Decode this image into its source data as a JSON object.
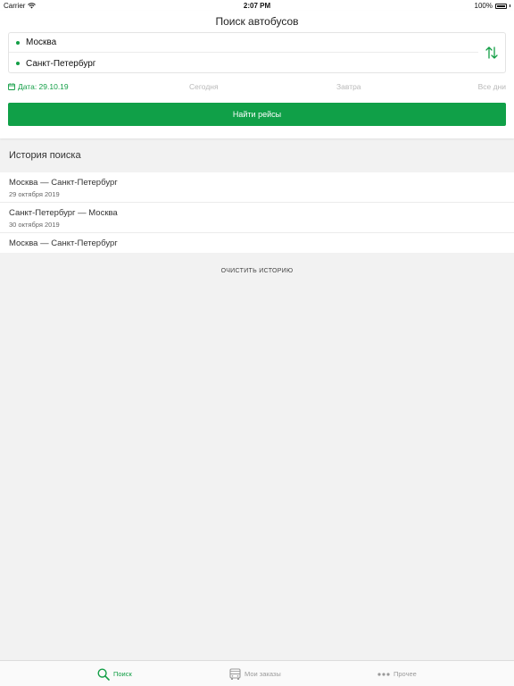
{
  "status_bar": {
    "carrier": "Carrier",
    "time": "2:07 PM",
    "battery": "100%",
    "icons": [
      "wifi-icon",
      "battery-icon"
    ]
  },
  "header": {
    "title": "Поиск автобусов"
  },
  "route": {
    "from": "Москва",
    "to": "Санкт-Петербург",
    "swap_icon": "swap-vertical-arrows-icon"
  },
  "date_bar": {
    "selected": "Дата: 29.10.19",
    "today": "Сегодня",
    "tomorrow": "Завтра",
    "all_days": "Все дни",
    "icon": "calendar-icon"
  },
  "find_button": {
    "label": "Найти рейсы"
  },
  "history": {
    "title": "История поиска",
    "items": [
      {
        "route": "Москва — Санкт-Петербург",
        "date": "29 октября 2019"
      },
      {
        "route": "Санкт-Петербург — Москва",
        "date": "30 октября 2019"
      },
      {
        "route": "Москва — Санкт-Петербург"
      }
    ],
    "clear_label": "ОЧИСТИТЬ ИСТОРИЮ"
  },
  "tab_bar": {
    "tabs": [
      {
        "label": "Поиск",
        "icon": "search-icon",
        "active": true
      },
      {
        "label": "Мои заказы",
        "icon": "bus-icon",
        "active": false
      },
      {
        "label": "Прочее",
        "icon": "more-dots-icon",
        "active": false
      }
    ]
  },
  "colors": {
    "accent": "#10a048",
    "background": "#f2f2f2",
    "inactive": "#9a9a9a"
  }
}
